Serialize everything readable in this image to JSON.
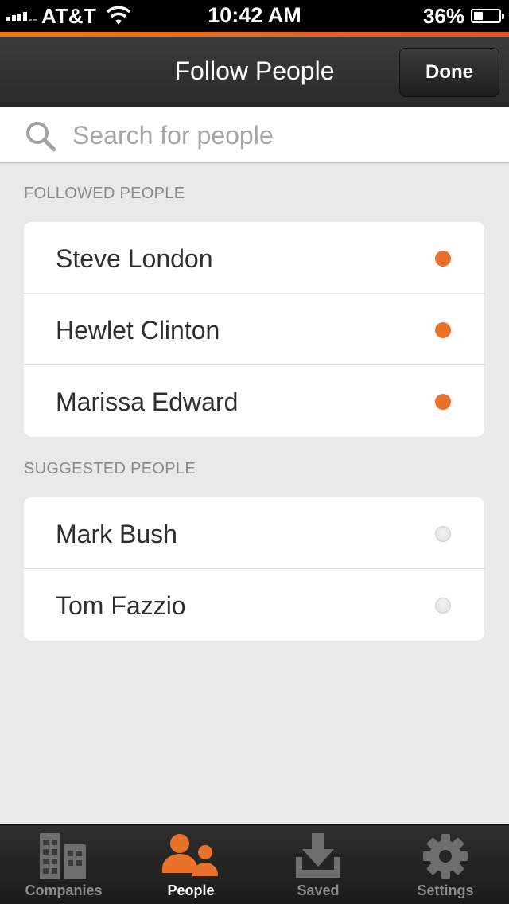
{
  "status_bar": {
    "carrier": "AT&T",
    "time": "10:42 AM",
    "battery": "36%",
    "battery_level": 0.36
  },
  "nav": {
    "title": "Follow People",
    "done_label": "Done"
  },
  "search": {
    "placeholder": "Search for people",
    "value": ""
  },
  "followed": {
    "header": "FOLLOWED PEOPLE",
    "people": [
      {
        "name": "Steve London",
        "following": true
      },
      {
        "name": "Hewlet Clinton",
        "following": true
      },
      {
        "name": "Marissa Edward",
        "following": true
      }
    ]
  },
  "suggested": {
    "header": "SUGGESTED PEOPLE",
    "people": [
      {
        "name": "Mark Bush",
        "following": false
      },
      {
        "name": "Tom Fazzio",
        "following": false
      }
    ]
  },
  "tabs": [
    {
      "label": "Companies",
      "icon": "buildings-icon",
      "active": false
    },
    {
      "label": "People",
      "icon": "people-icon",
      "active": true
    },
    {
      "label": "Saved",
      "icon": "download-tray-icon",
      "active": false
    },
    {
      "label": "Settings",
      "icon": "gear-icon",
      "active": false
    }
  ],
  "colors": {
    "accent": "#e8722a",
    "inactive_tab": "#8c8c8c"
  }
}
